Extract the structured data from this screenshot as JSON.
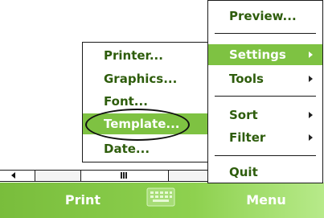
{
  "softkeys": {
    "left": "Print",
    "right": "Menu"
  },
  "main_menu": {
    "items": [
      {
        "label": "Preview...",
        "submenu": false,
        "selected": false
      },
      {
        "label": "Settings",
        "submenu": true,
        "selected": true
      },
      {
        "label": "Tools",
        "submenu": true,
        "selected": false
      },
      {
        "label": "Sort",
        "submenu": true,
        "selected": false
      },
      {
        "label": "Filter",
        "submenu": true,
        "selected": false
      },
      {
        "label": "Quit",
        "submenu": false,
        "selected": false
      }
    ]
  },
  "settings_submenu": {
    "items": [
      {
        "label": "Printer...",
        "selected": false
      },
      {
        "label": "Graphics...",
        "selected": false
      },
      {
        "label": "Font...",
        "selected": false
      },
      {
        "label": "Template...",
        "selected": true
      },
      {
        "label": "Date...",
        "selected": false
      }
    ]
  },
  "colors": {
    "accent": "#7ec242",
    "menu_text": "#2e5d0c",
    "softbar_text": "#ffffff"
  },
  "icons": {
    "keyboard": "keyboard-icon",
    "scroll_left": "arrow-left-icon",
    "scroll_thumb": "scroll-grip-icon"
  }
}
